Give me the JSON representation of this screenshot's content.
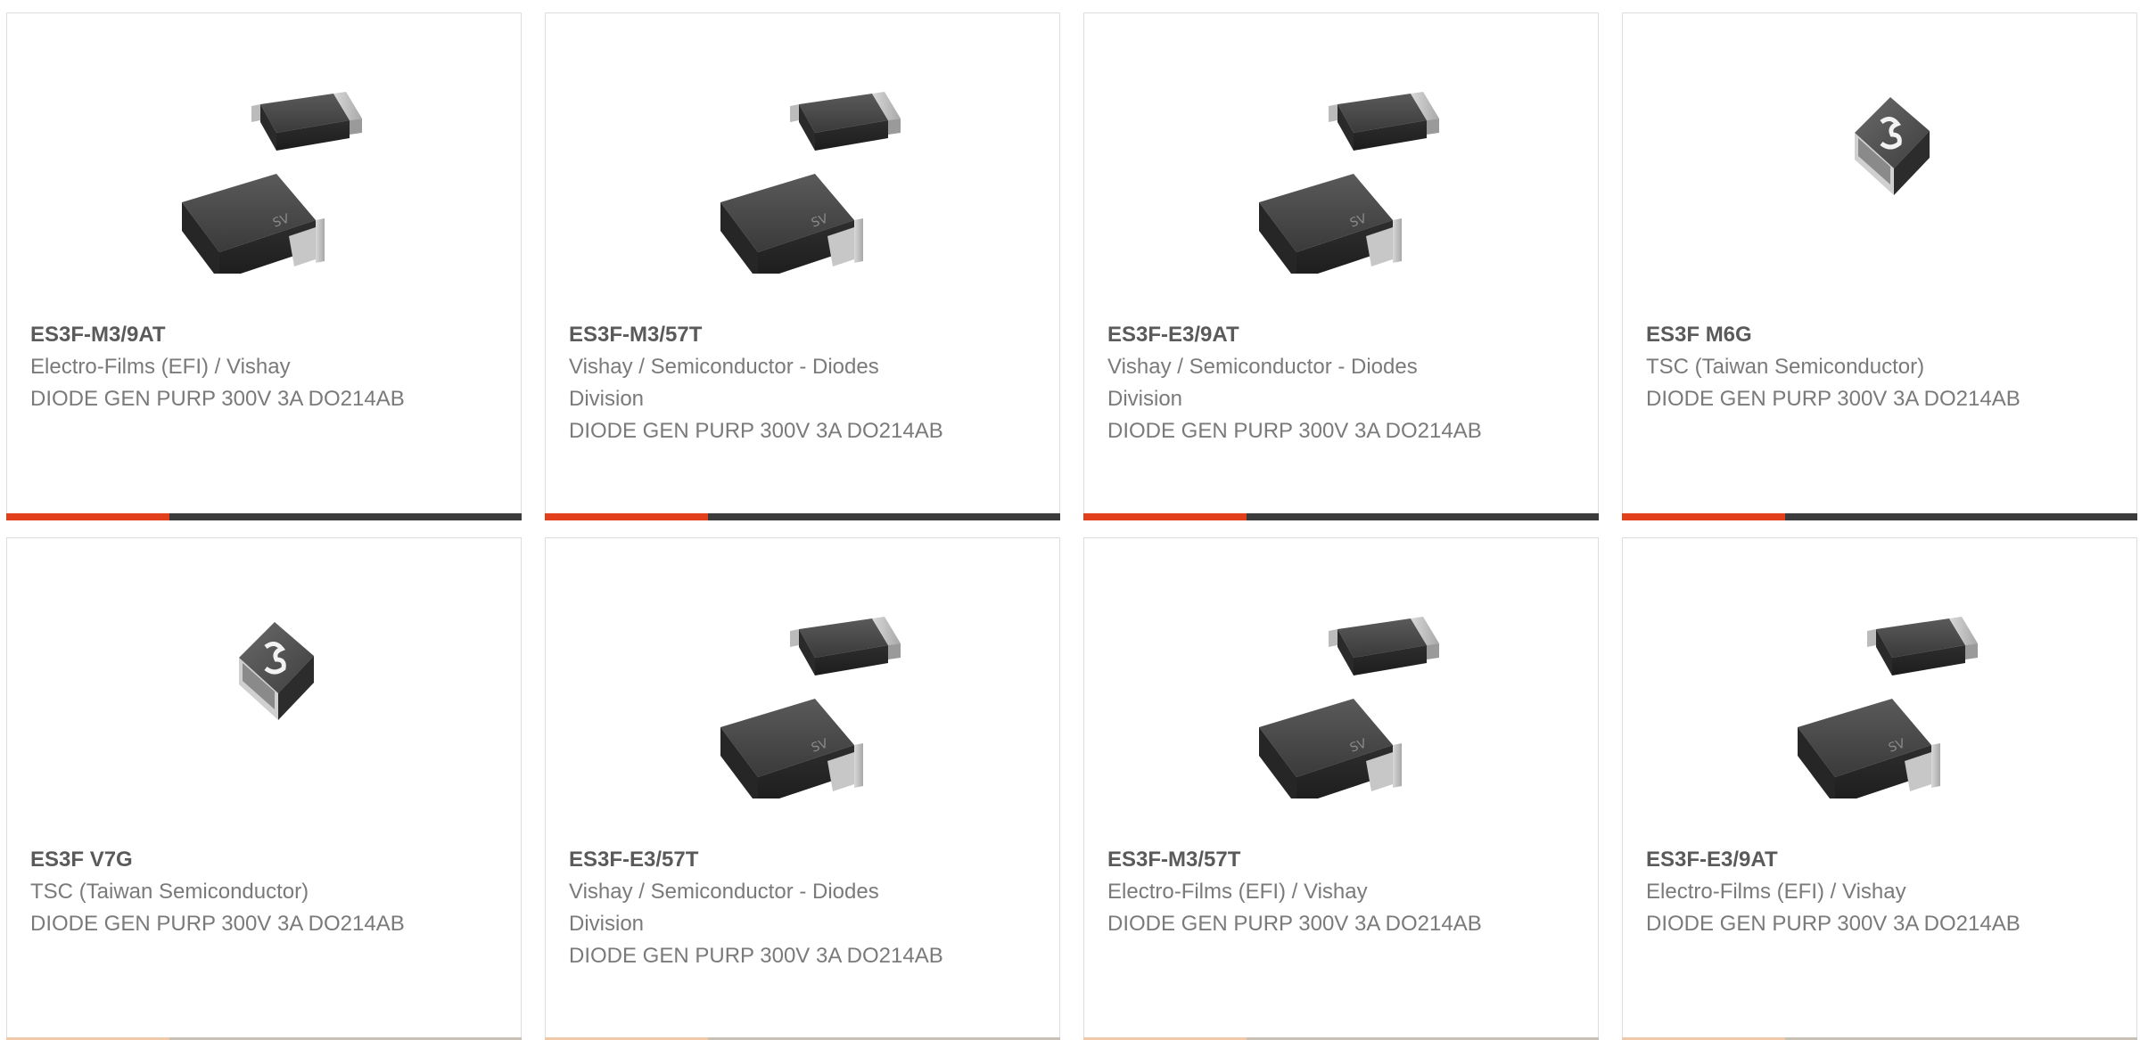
{
  "products": [
    {
      "part_number": "ES3F-M3/9AT",
      "manufacturer": "Electro-Films (EFI) / Vishay",
      "description": "DIODE GEN PURP 300V 3A DO214AB",
      "image": "smc-package-pair-icon"
    },
    {
      "part_number": "ES3F-M3/57T",
      "manufacturer": "Vishay / Semiconductor - Diodes Division",
      "description": "DIODE GEN PURP 300V 3A DO214AB",
      "image": "smc-package-pair-icon"
    },
    {
      "part_number": "ES3F-E3/9AT",
      "manufacturer": "Vishay / Semiconductor - Diodes Division",
      "description": "DIODE GEN PURP 300V 3A DO214AB",
      "image": "smc-package-pair-icon"
    },
    {
      "part_number": "ES3F M6G",
      "manufacturer": "TSC (Taiwan Semiconductor)",
      "description": "DIODE GEN PURP 300V 3A DO214AB",
      "image": "tsc-package-icon"
    },
    {
      "part_number": "ES3F V7G",
      "manufacturer": "TSC (Taiwan Semiconductor)",
      "description": "DIODE GEN PURP 300V 3A DO214AB",
      "image": "tsc-package-icon"
    },
    {
      "part_number": "ES3F-E3/57T",
      "manufacturer": "Vishay / Semiconductor - Diodes Division",
      "description": "DIODE GEN PURP 300V 3A DO214AB",
      "image": "smc-package-pair-icon"
    },
    {
      "part_number": "ES3F-M3/57T",
      "manufacturer": "Electro-Films (EFI) / Vishay",
      "description": "DIODE GEN PURP 300V 3A DO214AB",
      "image": "smc-package-pair-icon"
    },
    {
      "part_number": "ES3F-E3/9AT",
      "manufacturer": "Electro-Films (EFI) / Vishay",
      "description": "DIODE GEN PURP 300V 3A DO214AB",
      "image": "smc-package-pair-icon"
    }
  ],
  "colors": {
    "accent": "#e2401c",
    "bar": "#3c3c3c",
    "part_number": "#5a5a5a",
    "body_text": "#7a7a7a"
  }
}
